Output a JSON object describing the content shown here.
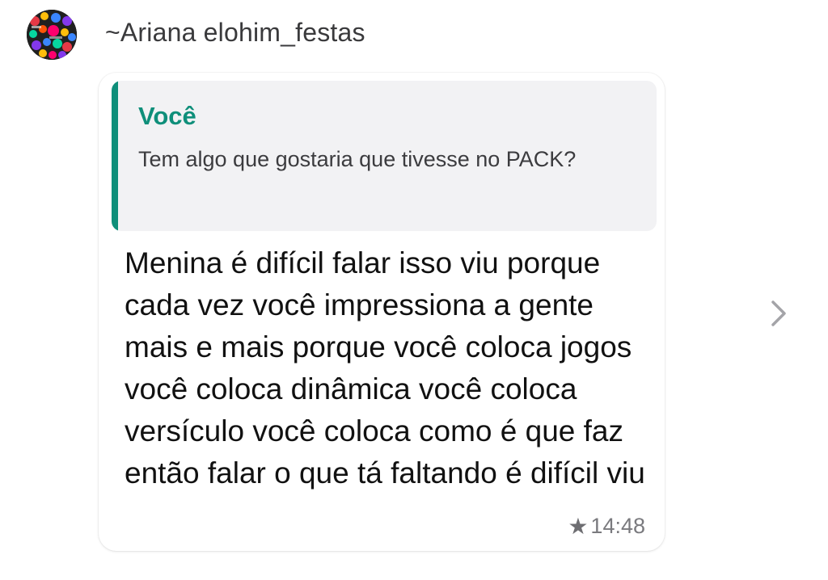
{
  "sender": {
    "name": "~Ariana elohim_festas",
    "avatar_icon": "colorful-confetti-avatar"
  },
  "message": {
    "quoted": {
      "author": "Você",
      "text": "Tem algo que gostaria que tivesse no PACK?"
    },
    "text": "Menina é difícil falar isso viu porque cada vez você impressiona a gente mais e mais porque você coloca jogos você coloca dinâmica você coloca versículo você coloca como é que faz então falar o que tá faltando é difícil viu",
    "time": "14:48",
    "starred_icon": "star-icon"
  },
  "colors": {
    "quote_accent": "#0f8f7a",
    "bubble_bg": "#ffffff",
    "quote_bg": "#f2f2f4"
  },
  "nav": {
    "chevron_icon": "chevron-right-icon"
  }
}
